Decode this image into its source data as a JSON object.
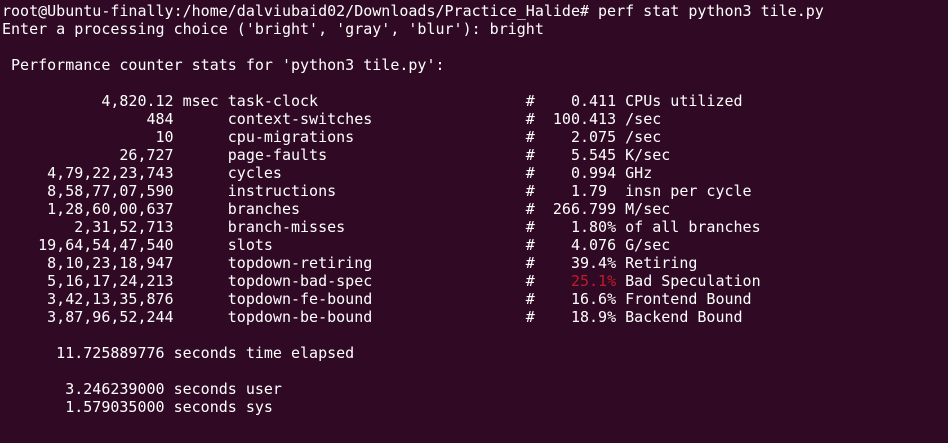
{
  "colors": {
    "background": "#300a24",
    "foreground": "#ffffff",
    "highlight": "#c01c28"
  },
  "terminal": {
    "prompt_line": "root@Ubuntu-finally:/home/dalviubaid02/Downloads/Practice_Halide# perf stat python3 tile.py",
    "input_line": "Enter a processing choice ('bright', 'gray', 'blur'): bright",
    "stats_header": " Performance counter stats for 'python3 tile.py':",
    "counters": [
      {
        "value": "4,820.12",
        "unit": "msec",
        "event": "task-clock",
        "metric": "0.411",
        "desc": "CPUs utilized",
        "highlight": false
      },
      {
        "value": "484",
        "unit": "",
        "event": "context-switches",
        "metric": "100.413",
        "desc": "/sec",
        "highlight": false
      },
      {
        "value": "10",
        "unit": "",
        "event": "cpu-migrations",
        "metric": "2.075",
        "desc": "/sec",
        "highlight": false
      },
      {
        "value": "26,727",
        "unit": "",
        "event": "page-faults",
        "metric": "5.545",
        "desc": "K/sec",
        "highlight": false
      },
      {
        "value": "4,79,22,23,743",
        "unit": "",
        "event": "cycles",
        "metric": "0.994",
        "desc": "GHz",
        "highlight": false
      },
      {
        "value": "8,58,77,07,590",
        "unit": "",
        "event": "instructions",
        "metric": "1.79 ",
        "desc": "insn per cycle",
        "highlight": false
      },
      {
        "value": "1,28,60,00,637",
        "unit": "",
        "event": "branches",
        "metric": "266.799",
        "desc": "M/sec",
        "highlight": false
      },
      {
        "value": "2,31,52,713",
        "unit": "",
        "event": "branch-misses",
        "metric": "1.80%",
        "desc": "of all branches",
        "highlight": false
      },
      {
        "value": "19,64,54,47,540",
        "unit": "",
        "event": "slots",
        "metric": "4.076",
        "desc": "G/sec",
        "highlight": false
      },
      {
        "value": "8,10,23,18,947",
        "unit": "",
        "event": "topdown-retiring",
        "metric": "39.4%",
        "desc": "Retiring",
        "highlight": false
      },
      {
        "value": "5,16,17,24,213",
        "unit": "",
        "event": "topdown-bad-spec",
        "metric": "25.1%",
        "desc": "Bad Speculation",
        "highlight": true
      },
      {
        "value": "3,42,13,35,876",
        "unit": "",
        "event": "topdown-fe-bound",
        "metric": "16.6%",
        "desc": "Frontend Bound",
        "highlight": false
      },
      {
        "value": "3,87,96,52,244",
        "unit": "",
        "event": "topdown-be-bound",
        "metric": "18.9%",
        "desc": "Backend Bound",
        "highlight": false
      }
    ],
    "elapsed_line": "      11.725889776 seconds time elapsed",
    "user_line": "       3.246239000 seconds user",
    "sys_line": "       1.579035000 seconds sys"
  }
}
